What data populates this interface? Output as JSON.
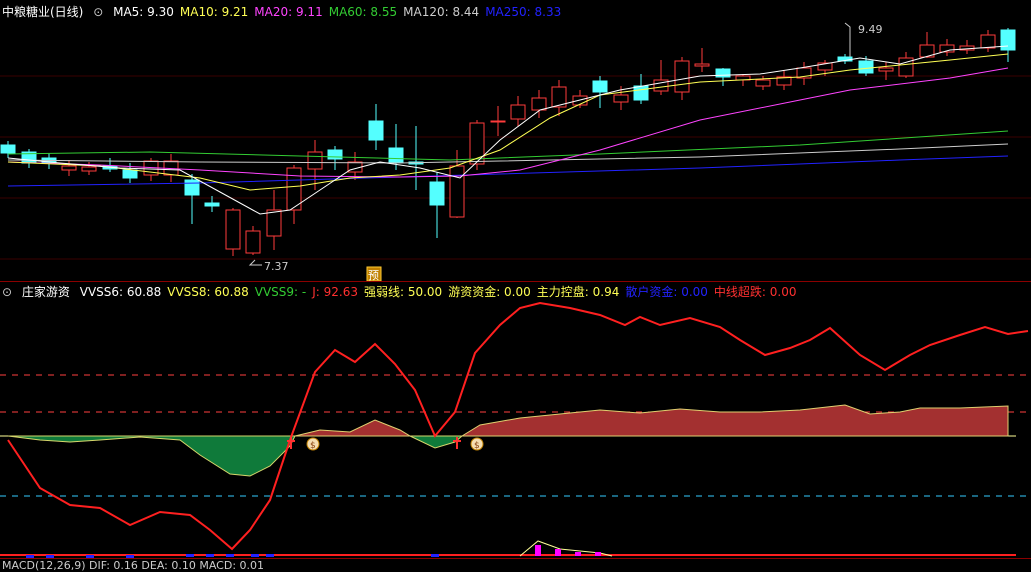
{
  "colors": {
    "up": "#ff3b3b",
    "down": "#54ffff",
    "ma5": "#ffffff",
    "ma10": "#ffff55",
    "ma20": "#ff44ff",
    "ma60": "#33cc33",
    "ma120": "#cccccc",
    "ma250": "#2222ff",
    "red_line": "#ff2020",
    "green_fill": "#0f7a3a",
    "red_fill": "#a33030"
  },
  "price_panel": {
    "stock_name": "中粮糖业(日线)",
    "ma": [
      {
        "label": "MA5: 9.30",
        "color": "#ffffff"
      },
      {
        "label": "MA10: 9.21",
        "color": "#ffff55"
      },
      {
        "label": "MA20: 9.11",
        "color": "#ff44ff"
      },
      {
        "label": "MA60: 8.55",
        "color": "#33cc33"
      },
      {
        "label": "MA120: 8.44",
        "color": "#cccccc"
      },
      {
        "label": "MA250: 8.33",
        "color": "#2222ff"
      }
    ],
    "high_label": "9.49",
    "low_label": "7.37",
    "marker_label": "预"
  },
  "indicator_panel": {
    "title": "庄家游资",
    "items": [
      {
        "label": "VVSS6: 60.88",
        "color": "#ffffff"
      },
      {
        "label": "VVSS8: 60.88",
        "color": "#ffff55"
      },
      {
        "label": "VVSS9: -",
        "color": "#33cc33"
      },
      {
        "label": "J: 92.63",
        "color": "#ff3030"
      },
      {
        "label": "强弱线: 50.00",
        "color": "#ffff55"
      },
      {
        "label": "游资资金: 0.00",
        "color": "#ffff55"
      },
      {
        "label": "主力控盘: 0.94",
        "color": "#ffff55"
      },
      {
        "label": "散户资金: 0.00",
        "color": "#2222ff"
      },
      {
        "label": "中线超跌: 0.00",
        "color": "#ff3030"
      }
    ]
  },
  "macd_panel": {
    "label": "MACD(12,26,9)  DIF: 0.16  DEA: 0.10  MACD: 0.01"
  }
}
